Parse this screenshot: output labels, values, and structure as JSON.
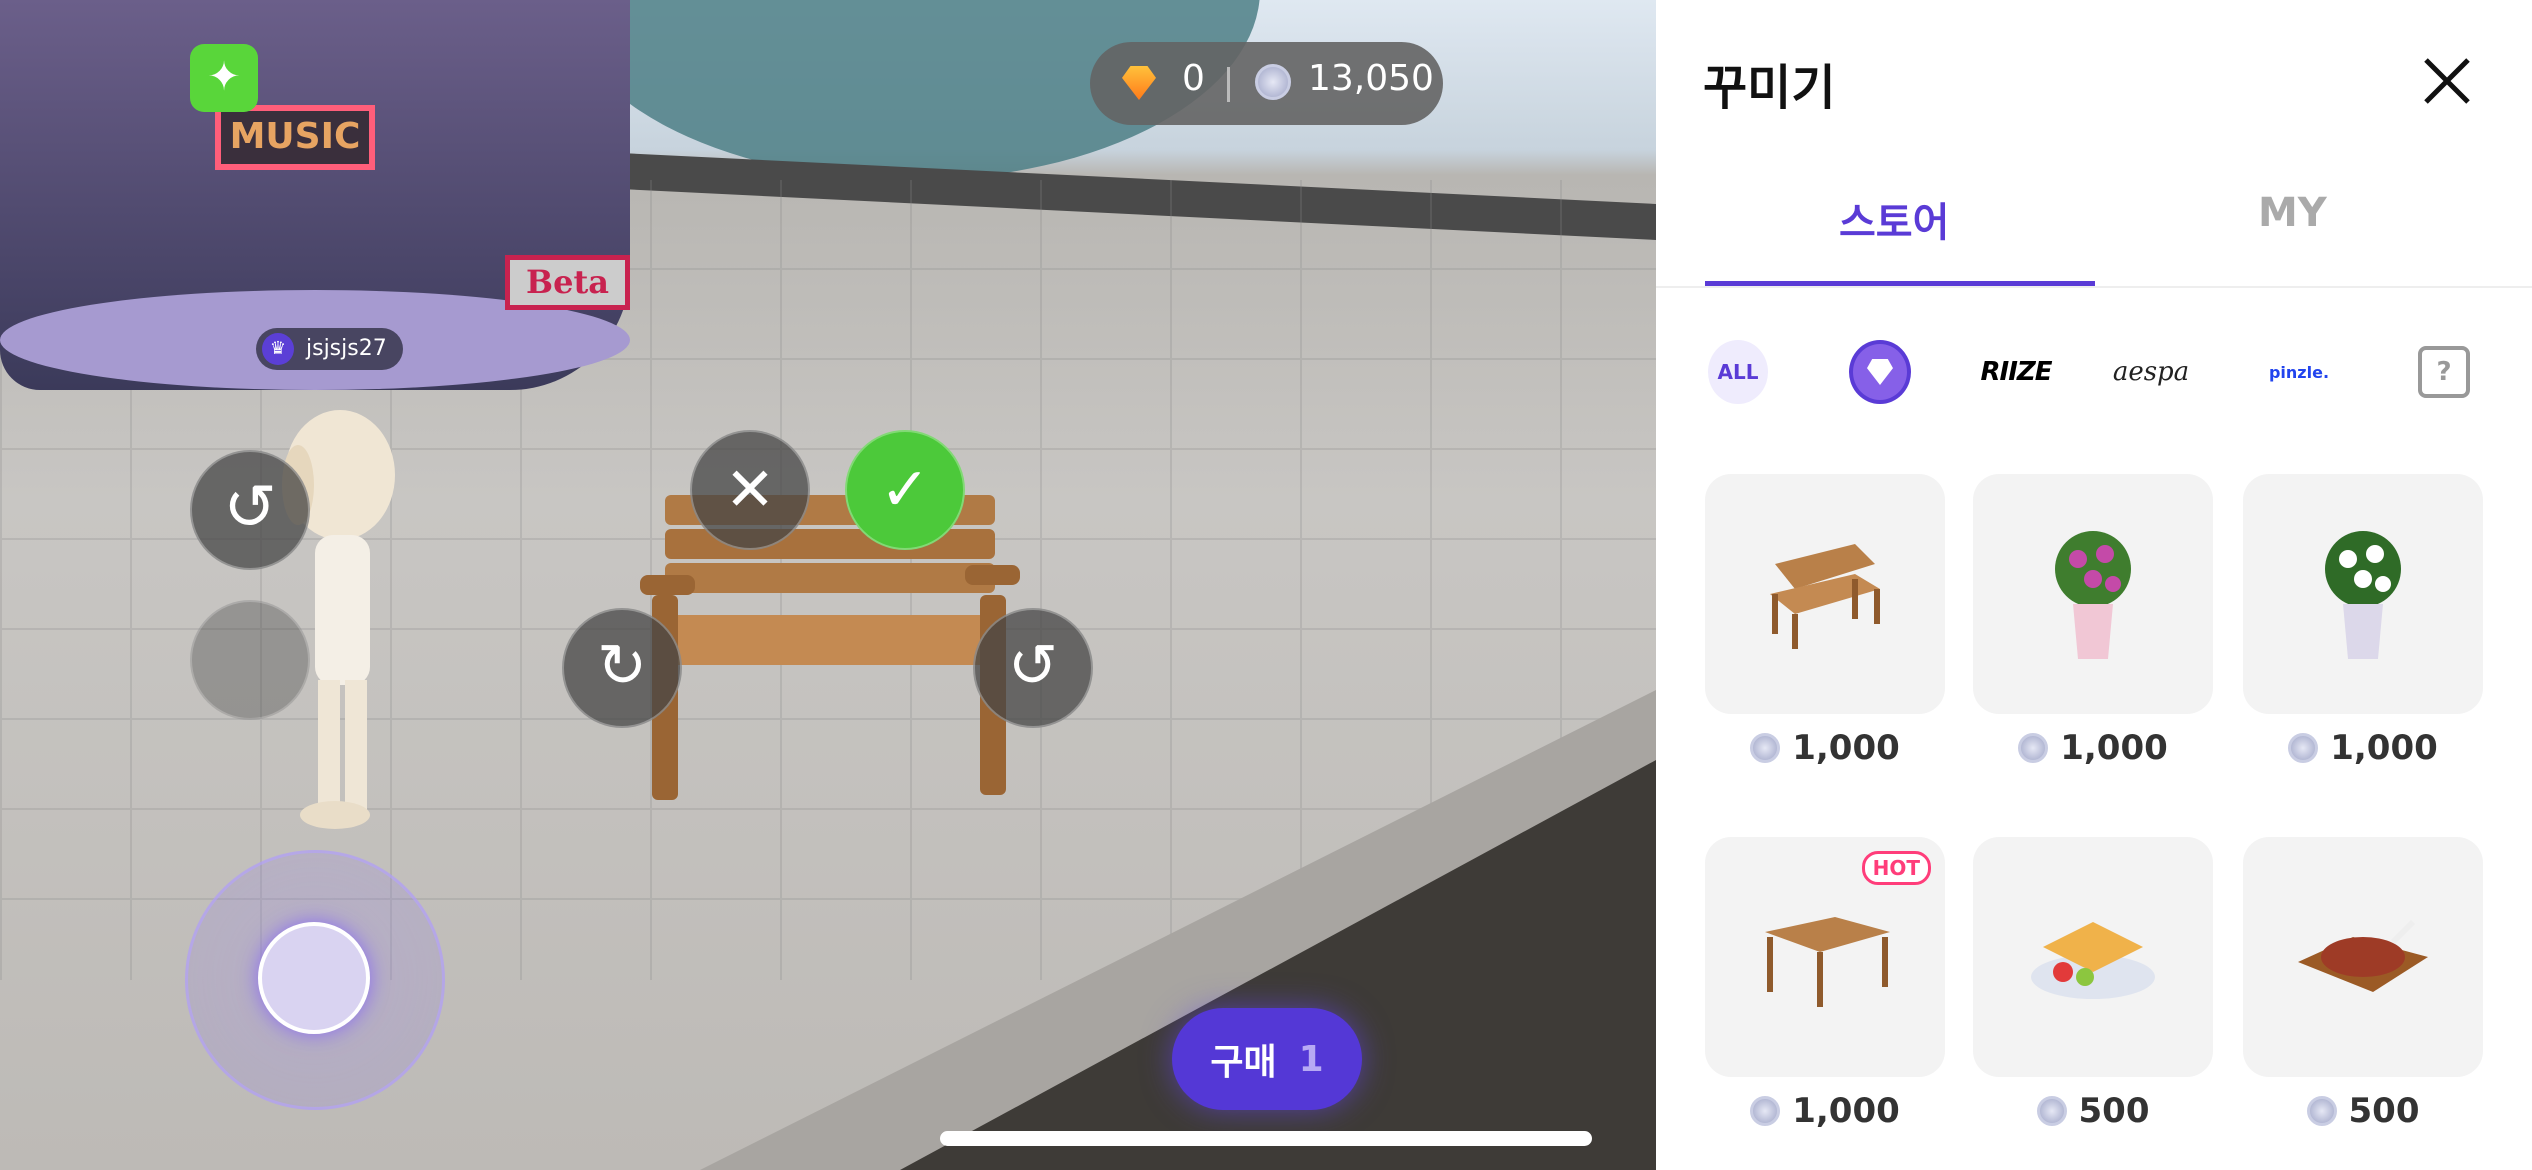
{
  "scene": {
    "signs": {
      "music": "MUSIC",
      "beta": "Beta"
    },
    "username": "jsjsjs27",
    "currency": {
      "gem": "0",
      "coin": "13,050"
    },
    "buy_button": {
      "label": "구매",
      "count": "1"
    },
    "colors": {
      "accent": "#5438d6",
      "confirm": "#4cc93a"
    }
  },
  "panel": {
    "title": "꾸미기",
    "tabs": [
      {
        "label": "스토어",
        "active": true
      },
      {
        "label": "MY",
        "active": false
      }
    ],
    "filters": [
      "ALL",
      "gem",
      "RIIZE",
      "aespa",
      "pinzle.",
      "?"
    ],
    "items": [
      {
        "name": "bench",
        "price": "1,000",
        "hot": false
      },
      {
        "name": "pink flower pot",
        "price": "1,000",
        "hot": false
      },
      {
        "name": "white flower pot",
        "price": "1,000",
        "hot": false
      },
      {
        "name": "wooden table",
        "price": "1,000",
        "hot": true,
        "badge": "HOT"
      },
      {
        "name": "waffle",
        "price": "500",
        "hot": false
      },
      {
        "name": "steak",
        "price": "500",
        "hot": false
      }
    ]
  }
}
